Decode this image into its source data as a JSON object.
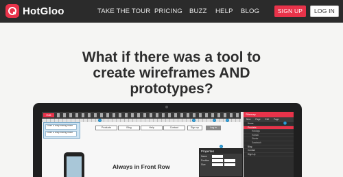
{
  "brand": {
    "name": "HotGloo",
    "accent": "#e8334a",
    "navbar_bg": "#2b2b2b"
  },
  "nav": {
    "tour": "TAKE THE TOUR",
    "pricing": "PRICING",
    "buzz": "BUZZ",
    "help": "HELP",
    "blog": "BLOG",
    "signup": "SIGN UP",
    "login": "LOG IN"
  },
  "hero": {
    "line1": "What if there was a tool to",
    "line2": "create wireframes AND",
    "line3": "prototypes?"
  },
  "app": {
    "edit": "Edit",
    "wireframe_nav": [
      "Products",
      "Blog",
      "Help",
      "Contact"
    ],
    "signup": "Sign up",
    "login": "Log in",
    "notes": [
      "Zoom & snap editing mode",
      "Zoom & snap editing mode"
    ],
    "front_label": "Always in Front Row",
    "properties": {
      "title": "Properties",
      "rows": [
        "Name",
        "Position",
        "Size"
      ]
    },
    "sitemap": {
      "title": "Sitemap",
      "actions": "New Page  Edit Page",
      "items": [
        "Home",
        "Products",
        "Hotdogs",
        "Hotstar",
        "Starter",
        "Sandwich",
        "Blog",
        "Contact",
        "Sign Up"
      ]
    }
  }
}
